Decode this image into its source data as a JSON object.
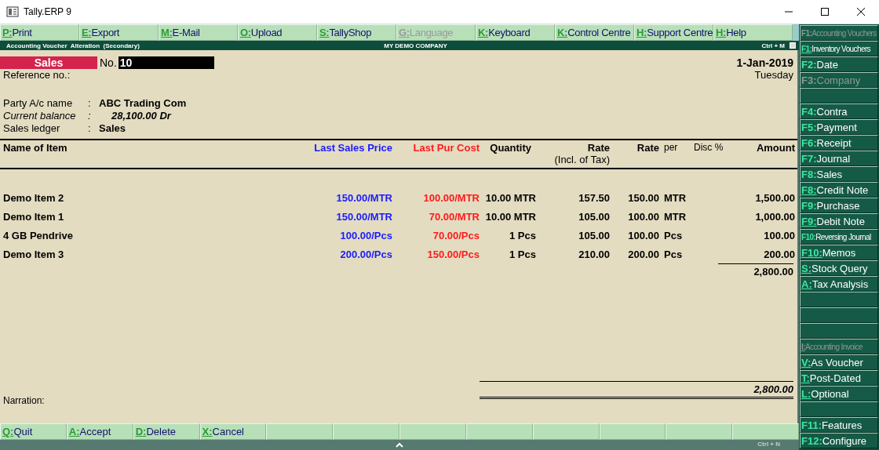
{
  "window": {
    "title": "Tally.ERP 9"
  },
  "menu": [
    {
      "key": "P:",
      "label": "Print",
      "disabled": false
    },
    {
      "key": "E:",
      "label": "Export",
      "disabled": false
    },
    {
      "key": "M:",
      "label": "E-Mail",
      "disabled": false
    },
    {
      "key": "O:",
      "label": "Upload",
      "disabled": false
    },
    {
      "key": "S:",
      "label": "TallyShop",
      "disabled": false
    },
    {
      "key": "G:",
      "label": "Language",
      "disabled": true
    },
    {
      "key": "K:",
      "label": "Keyboard",
      "disabled": false
    },
    {
      "key": "K:",
      "label": "Control Centre",
      "disabled": false
    },
    {
      "key": "H:",
      "label": "Support Centre",
      "disabled": false
    },
    {
      "key": "H:",
      "label": "Help",
      "disabled": false
    }
  ],
  "header": {
    "title": "Accounting Voucher  Alteration  (Secondary)",
    "company": "MY DEMO COMPANY",
    "shortcut": "Ctrl + M"
  },
  "voucher": {
    "type": "Sales",
    "number_label": "No.",
    "number": "10",
    "date": "1-Jan-2019",
    "day": "Tuesday",
    "reference_label": "Reference no.:"
  },
  "party_fields": [
    {
      "label": "Party A/c name",
      "separator": ":",
      "value": "ABC Trading Com",
      "italic": false
    },
    {
      "label": "Current balance",
      "separator": ":",
      "value": "28,100.00 Dr",
      "italic": true
    },
    {
      "label": "Sales ledger",
      "separator": ":",
      "value": "Sales",
      "italic": false
    }
  ],
  "table": {
    "columns": [
      {
        "label": "Name of Item",
        "color": "#000000",
        "bold": true
      },
      {
        "label": "Last Sales Price",
        "color": "#1a1aff",
        "bold": true
      },
      {
        "label": "Last Pur Cost",
        "color": "#ff1a1a",
        "bold": true
      },
      {
        "label": "Quantity",
        "color": "#000000",
        "bold": true
      },
      {
        "label": "Rate",
        "sublabel": "(Incl. of Tax)",
        "color": "#000000",
        "bold": true
      },
      {
        "label": "Rate",
        "color": "#000000",
        "bold": true
      },
      {
        "label": "per",
        "color": "#000000",
        "bold": false
      },
      {
        "label": "Disc %",
        "color": "#000000",
        "bold": false
      },
      {
        "label": "Amount",
        "color": "#000000",
        "bold": true
      }
    ],
    "rows": [
      {
        "name": "Demo Item 2",
        "last_sales_price": "150.00/MTR",
        "last_pur_cost": "100.00/MTR",
        "quantity": "10.00 MTR",
        "rate_incl_tax": "157.50",
        "rate": "150.00",
        "per": "MTR",
        "amount": "1,500.00"
      },
      {
        "name": "Demo Item 1",
        "last_sales_price": "150.00/MTR",
        "last_pur_cost": "70.00/MTR",
        "quantity": "10.00 MTR",
        "rate_incl_tax": "105.00",
        "rate": "100.00",
        "per": "MTR",
        "amount": "1,000.00"
      },
      {
        "name": "4 GB Pendrive",
        "last_sales_price": "100.00/Pcs",
        "last_pur_cost": "70.00/Pcs",
        "quantity": "1 Pcs",
        "rate_incl_tax": "105.00",
        "rate": "100.00",
        "per": "Pcs",
        "amount": "100.00"
      },
      {
        "name": "Demo Item 3",
        "last_sales_price": "200.00/Pcs",
        "last_pur_cost": "150.00/Pcs",
        "quantity": "1 Pcs",
        "rate_incl_tax": "210.00",
        "rate": "200.00",
        "per": "Pcs",
        "amount": "200.00"
      }
    ],
    "subtotal": "2,800.00"
  },
  "narration": {
    "label": "Narration:",
    "total": "2,800.00"
  },
  "footer_buttons": [
    {
      "kind": "action",
      "key": "Q:",
      "label": "Quit"
    },
    {
      "kind": "action",
      "key": "A:",
      "label": "Accept"
    },
    {
      "kind": "action",
      "key": "D:",
      "label": "Delete"
    },
    {
      "kind": "action",
      "key": "X:",
      "label": "Cancel"
    },
    {
      "kind": "blank"
    },
    {
      "kind": "blank"
    },
    {
      "kind": "blank"
    },
    {
      "kind": "blank"
    },
    {
      "kind": "blank"
    },
    {
      "kind": "blank"
    },
    {
      "kind": "blank"
    },
    {
      "kind": "blank"
    }
  ],
  "footer_strip": {
    "shortcut": "Ctrl + N"
  },
  "sidebar": [
    {
      "kind": "action",
      "key": "F1:",
      "label": "Accounting Vouchers",
      "disabled": true,
      "underlined": false
    },
    {
      "kind": "action",
      "key": "F1:",
      "label": "Inventory Vouchers",
      "disabled": false,
      "underlined": true
    },
    {
      "kind": "action",
      "key": "F2:",
      "label": "Date",
      "disabled": false,
      "underlined": false
    },
    {
      "kind": "action",
      "key": "F3:",
      "label": "Company",
      "disabled": true,
      "underlined": false
    },
    {
      "kind": "blank"
    },
    {
      "kind": "action",
      "key": "F4:",
      "label": "Contra",
      "disabled": false,
      "underlined": false
    },
    {
      "kind": "action",
      "key": "F5:",
      "label": "Payment",
      "disabled": false,
      "underlined": false
    },
    {
      "kind": "action",
      "key": "F6:",
      "label": "Receipt",
      "disabled": false,
      "underlined": false
    },
    {
      "kind": "action",
      "key": "F7:",
      "label": "Journal",
      "disabled": false,
      "underlined": false
    },
    {
      "kind": "action",
      "key": "F8:",
      "label": "Sales",
      "disabled": false,
      "underlined": false
    },
    {
      "kind": "action",
      "key": "F8:",
      "label": "Credit Note",
      "disabled": false,
      "underlined": true
    },
    {
      "kind": "action",
      "key": "F9:",
      "label": "Purchase",
      "disabled": false,
      "underlined": false
    },
    {
      "kind": "action",
      "key": "F9:",
      "label": "Debit Note",
      "disabled": false,
      "underlined": true
    },
    {
      "kind": "action",
      "key": "F10:",
      "label": "Reversing Journal",
      "disabled": false,
      "underlined": false
    },
    {
      "kind": "action",
      "key": "F10:",
      "label": "Memos",
      "disabled": false,
      "underlined": true
    },
    {
      "kind": "action",
      "key": "S:",
      "label": "Stock Query",
      "disabled": false,
      "underlined": true
    },
    {
      "kind": "action",
      "key": "A:",
      "label": "Tax Analysis",
      "disabled": false,
      "underlined": true
    },
    {
      "kind": "blank"
    },
    {
      "kind": "blank"
    },
    {
      "kind": "blank"
    },
    {
      "kind": "action",
      "key": "I:",
      "label": "Accounting Invoice",
      "disabled": true,
      "underlined": true
    },
    {
      "kind": "action",
      "key": "V:",
      "label": "As Voucher",
      "disabled": false,
      "underlined": true
    },
    {
      "kind": "action",
      "key": "T:",
      "label": "Post-Dated",
      "disabled": false,
      "underlined": true
    },
    {
      "kind": "action",
      "key": "L:",
      "label": "Optional",
      "disabled": false,
      "underlined": true
    },
    {
      "kind": "blank"
    },
    {
      "kind": "action",
      "key": "F11:",
      "label": "Features",
      "disabled": false,
      "underlined": false
    },
    {
      "kind": "action",
      "key": "F12:",
      "label": "Configure",
      "disabled": false,
      "underlined": false
    }
  ]
}
